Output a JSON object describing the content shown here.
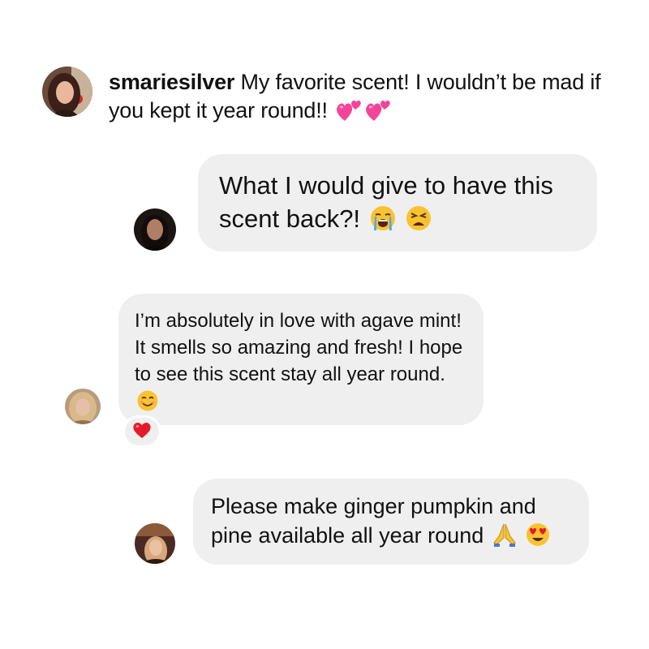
{
  "comments": [
    {
      "username": "smariesilver",
      "text": "My favorite scent! I wouldn’t be mad if you kept it year round!!",
      "emojis": [
        "two-hearts-icon",
        "two-hearts-icon"
      ]
    },
    {
      "text": "What I would give to have this scent back?!",
      "emojis": [
        "loudly-crying-face-icon",
        "weary-face-icon"
      ]
    },
    {
      "text": "I’m absolutely in love with agave mint! It smells so amazing and fresh! I hope to see this scent stay all year round.",
      "emojis": [
        "smiling-face-icon"
      ],
      "reaction": "red-heart-icon"
    },
    {
      "text": "Please make ginger pumpkin and pine available all year round",
      "emojis": [
        "folded-hands-icon",
        "heart-eyes-face-icon"
      ]
    }
  ],
  "colors": {
    "bubble": "#efefef",
    "text": "#111111",
    "heart_pink": "#f4449a",
    "heart_red": "#e31b2b",
    "emoji_yellow": "#f9c231"
  }
}
